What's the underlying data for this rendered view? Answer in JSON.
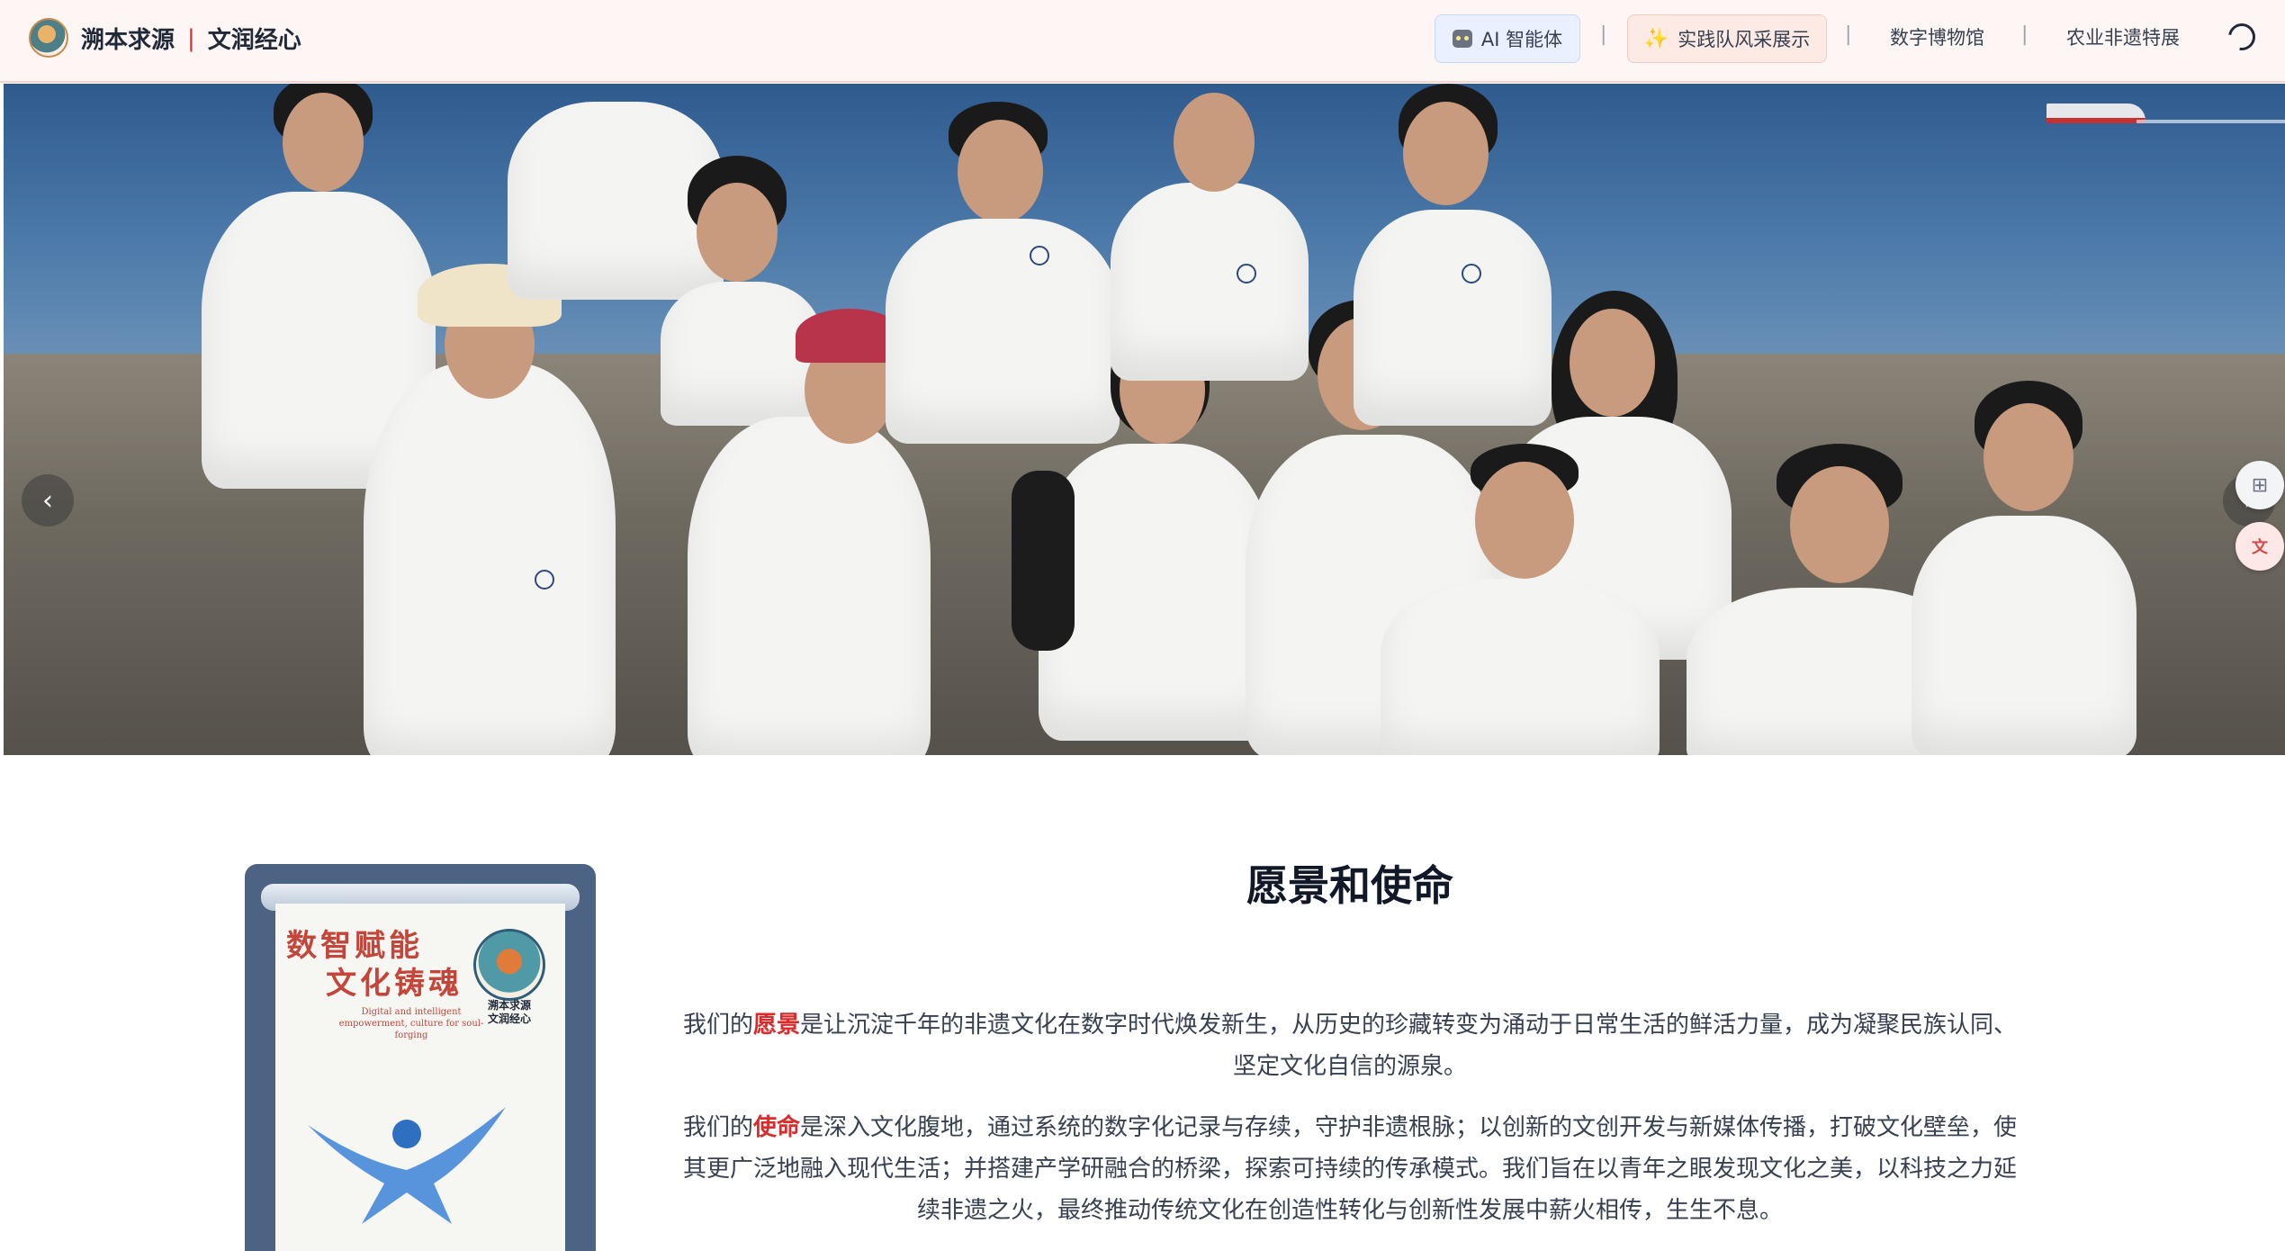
{
  "brand": {
    "name_left": "溯本求源",
    "separator": "|",
    "name_right": "文润经心"
  },
  "nav": {
    "ai_agent": "AI 智能体",
    "team_showcase": "实践队风采展示",
    "digital_museum": "数字博物馆",
    "agri_heritage": "农业非遗特展",
    "divider": "|"
  },
  "carousel": {
    "prev_icon": "chevron-left-icon",
    "next_icon": "chevron-right-icon",
    "slides_count": 4,
    "active_index": 0
  },
  "poster": {
    "title_line1": "数智赋能",
    "title_line2": "文化铸魂",
    "subtitle": "Digital and intelligent empowerment, culture for soul-forging",
    "brand_line1": "溯本求源",
    "brand_line2": "文润经心"
  },
  "vision": {
    "title": "愿景和使命",
    "p1_before": "我们的",
    "p1_highlight": "愿景",
    "p1_after": "是让沉淀千年的非遗文化在数字时代焕发新生，从历史的珍藏转变为涌动于日常生活的鲜活力量，成为凝聚民族认同、坚定文化自信的源泉。",
    "p2_before": "我们的",
    "p2_highlight": "使命",
    "p2_after": "是深入文化腹地，通过系统的数字化记录与存续，守护非遗根脉；以创新的文创开发与新媒体传播，打破文化壁垒，使其更广泛地融入现代生活；并搭建产学研融合的桥梁，探索可持续的传承模式。我们旨在以青年之眼发现文化之美，以科技之力延续非遗之火，最终推动传统文化在创造性转化与创新性发展中薪火相传，生生不息。"
  },
  "colors": {
    "accent_red": "#d92b2b",
    "nav_bg": "#fdf6f5"
  }
}
